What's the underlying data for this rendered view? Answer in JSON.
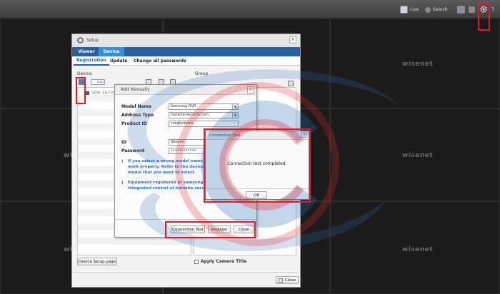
{
  "topbar": {
    "live_label": "Live",
    "search_label": "Search",
    "icons": [
      "layout-icon",
      "window-icon",
      "gear-icon",
      "help-icon"
    ]
  },
  "grid": {
    "brand": "wisenet",
    "tiles_visible": [
      "wisenet",
      "wisenet",
      "wisenet",
      "wisenet",
      "wisenet"
    ]
  },
  "setup": {
    "title": "Setup",
    "tabs": [
      "Viewer",
      "Device"
    ],
    "subtabs": [
      "Registration",
      "Update",
      "Change all passwords"
    ],
    "device_label": "Device",
    "group_label": "Group",
    "auto_label": "Auto",
    "device_item": "SRN-1673S_",
    "device_setup_button": "Device Setup page",
    "apply_camera_title": "Apply Camera Title",
    "close_button": "Close"
  },
  "add_manually": {
    "title": "Add Manually",
    "model_name_label": "Model Name",
    "model_name_value": "Samsung DVR",
    "address_type_label": "Address Type",
    "address_type_value": "hanwha-security.com",
    "product_id_label": "Product ID",
    "product_id_value": "congtydaien",
    "id_label": "ID",
    "id_value": "daianm",
    "password_label": "Password",
    "password_value": "••••••••••••",
    "note1_lines": [
      "If you select a wrong model name, it m",
      "work properly. Refer to the device m",
      "model that you want to select."
    ],
    "note2_lines": [
      "Equipment registered at samsungipo",
      "integrated control at hanwha-securit"
    ],
    "connection_test_button": "Connection Test",
    "register_button": "Register",
    "close_button": "Close"
  },
  "connection_test": {
    "title": "Connection Test",
    "message": "Connection test completed.",
    "ok_button": "OK"
  },
  "colors": {
    "tab_bar": "#2b5f9e",
    "tab_active": "#3a8ddd",
    "highlight": "#e21b2a",
    "note_text": "#2a6fcf"
  }
}
